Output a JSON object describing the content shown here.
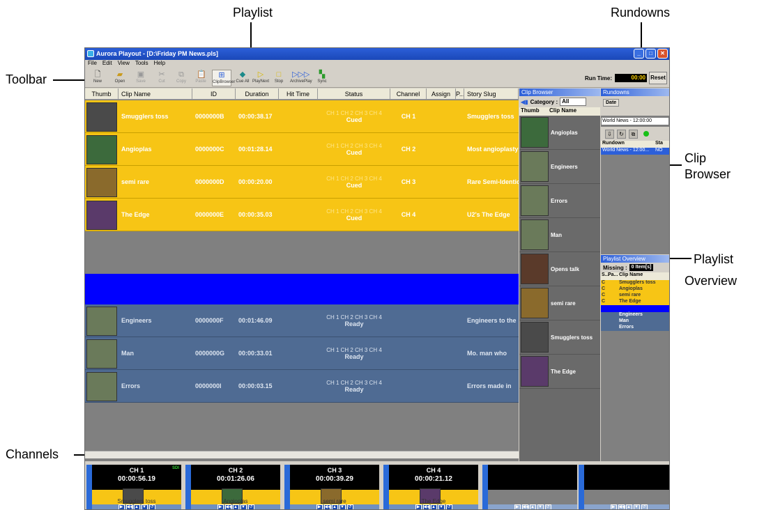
{
  "callouts": {
    "playlist": "Playlist",
    "rundowns": "Rundowns",
    "toolbar": "Toolbar",
    "clip_browser_1": "Clip",
    "clip_browser_2": "Browser",
    "playlist_overview_1": "Playlist",
    "playlist_overview_2": "Overview",
    "channels": "Channels"
  },
  "window": {
    "title": "Aurora Playout - [D:\\Friday PM News.pls]"
  },
  "menu": [
    "File",
    "Edit",
    "View",
    "Tools",
    "Help"
  ],
  "toolbar": {
    "buttons": [
      {
        "label": "New",
        "icon": "new-file-icon"
      },
      {
        "label": "Open",
        "icon": "open-folder-icon"
      },
      {
        "label": "Save",
        "icon": "save-icon"
      },
      {
        "label": "Cut",
        "icon": "cut-icon"
      },
      {
        "label": "Copy",
        "icon": "copy-icon"
      },
      {
        "label": "Paste",
        "icon": "paste-icon"
      },
      {
        "label": "ClipBrowser",
        "icon": "clip-browser-icon"
      },
      {
        "label": "Cue All",
        "icon": "cue-all-icon"
      },
      {
        "label": "PlayNext",
        "icon": "play-next-icon"
      },
      {
        "label": "Stop",
        "icon": "stop-icon"
      },
      {
        "label": "ArchivePlay",
        "icon": "archive-play-icon"
      },
      {
        "label": "Sync",
        "icon": "sync-icon"
      }
    ],
    "run_time_label": "Run Time:",
    "run_time_value": "00:00",
    "reset_label": "Reset"
  },
  "playlist": {
    "columns": [
      "Thumb",
      "Clip Name",
      "ID",
      "Duration",
      "Hit Time",
      "Status",
      "Channel",
      "Assign",
      "P...",
      "Story Slug"
    ],
    "rows": [
      {
        "clip": "Smugglers toss",
        "id": "0000000B",
        "duration": "00:00:38.17",
        "hit": "",
        "status_channels": "CH 1 CH 2 CH 3 CH 4",
        "status": "Cued",
        "channel": "CH 1",
        "slug": "Smugglers toss",
        "state": "cued"
      },
      {
        "clip": "Angioplas",
        "id": "0000000C",
        "duration": "00:01:28.14",
        "hit": "",
        "status_channels": "CH 1 CH 2 CH 3 CH 4",
        "status": "Cued",
        "channel": "CH 2",
        "slug": "Most angioplasty",
        "state": "cued"
      },
      {
        "clip": "semi rare",
        "id": "0000000D",
        "duration": "00:00:20.00",
        "hit": "",
        "status_channels": "CH 1 CH 2 CH 3 CH 4",
        "status": "Cued",
        "channel": "CH 3",
        "slug": "Rare Semi-Identical",
        "state": "cued"
      },
      {
        "clip": "The Edge",
        "id": "0000000E",
        "duration": "00:00:35.03",
        "hit": "",
        "status_channels": "CH 1 CH 2 CH 3 CH 4",
        "status": "Cued",
        "channel": "CH 4",
        "slug": "U2's The Edge",
        "state": "cued"
      },
      {
        "clip": "Engineers",
        "id": "0000000F",
        "duration": "00:01:46.09",
        "hit": "",
        "status_channels": "CH 1 CH 2 CH 3 CH 4",
        "status": "Ready",
        "channel": "",
        "slug": "Engineers to the",
        "state": "ready"
      },
      {
        "clip": "Man",
        "id": "0000000G",
        "duration": "00:00:33.01",
        "hit": "",
        "status_channels": "CH 1 CH 2 CH 3 CH 4",
        "status": "Ready",
        "channel": "",
        "slug": "Mo. man who",
        "state": "ready"
      },
      {
        "clip": "Errors",
        "id": "0000000I",
        "duration": "00:00:03.15",
        "hit": "",
        "status_channels": "CH 1 CH 2 CH 3 CH 4",
        "status": "Ready",
        "channel": "",
        "slug": "Errors made in",
        "state": "ready"
      }
    ]
  },
  "clip_browser": {
    "title": "Clip Browser",
    "category_label": "Category :",
    "category_value": "All",
    "columns": [
      "Thumb",
      "Clip Name"
    ],
    "clips": [
      "Angioplas",
      "Engineers",
      "Errors",
      "Man",
      "Opens talk",
      "semi rare",
      "Smugglers toss",
      "The Edge"
    ]
  },
  "rundowns": {
    "title": "Rundowns",
    "date_button": "Date",
    "selected": "World News - 12:00:00",
    "columns": [
      "Rundown",
      "Sta"
    ],
    "rows": [
      {
        "name": "World News - 12:00...",
        "status": "NO"
      }
    ]
  },
  "overview": {
    "title": "Playlist Overview",
    "missing_label": "Missing :",
    "missing_value": "0 Item[s]",
    "columns": [
      "S...",
      "Pa...",
      "Clip Name"
    ],
    "rows": [
      {
        "s": "C",
        "name": "Smugglers toss",
        "state": "c"
      },
      {
        "s": "C",
        "name": "Angioplas",
        "state": "c"
      },
      {
        "s": "C",
        "name": "semi rare",
        "state": "c"
      },
      {
        "s": "C",
        "name": "The Edge",
        "state": "c"
      },
      {
        "s": "",
        "name": "Engineers",
        "state": "r"
      },
      {
        "s": "",
        "name": "Man",
        "state": "r"
      },
      {
        "s": "",
        "name": "Errors",
        "state": "r"
      }
    ]
  },
  "channels": [
    {
      "name": "CH 1",
      "time": "00:00:56.19",
      "clip": "Smugglers toss",
      "badge": "SDI",
      "side": "Channel 1"
    },
    {
      "name": "CH 2",
      "time": "00:01:26.06",
      "clip": "Angioplas",
      "badge": "",
      "side": "Channel 2"
    },
    {
      "name": "CH 3",
      "time": "00:00:39.29",
      "clip": "semi rare",
      "badge": "",
      "side": "Channel 3"
    },
    {
      "name": "CH 4",
      "time": "00:00:21.12",
      "clip": "The Edge",
      "badge": "",
      "side": "Channel 4"
    },
    {
      "name": "",
      "time": "",
      "clip": "",
      "badge": "",
      "side": "Channel 5"
    },
    {
      "name": "",
      "time": "",
      "clip": "",
      "badge": "",
      "side": "Channel 6"
    }
  ],
  "colors": {
    "cued": "#f7c515",
    "ready": "#4f6b93",
    "separator": "#0000ff",
    "title_bar": "#2c5fd9"
  }
}
